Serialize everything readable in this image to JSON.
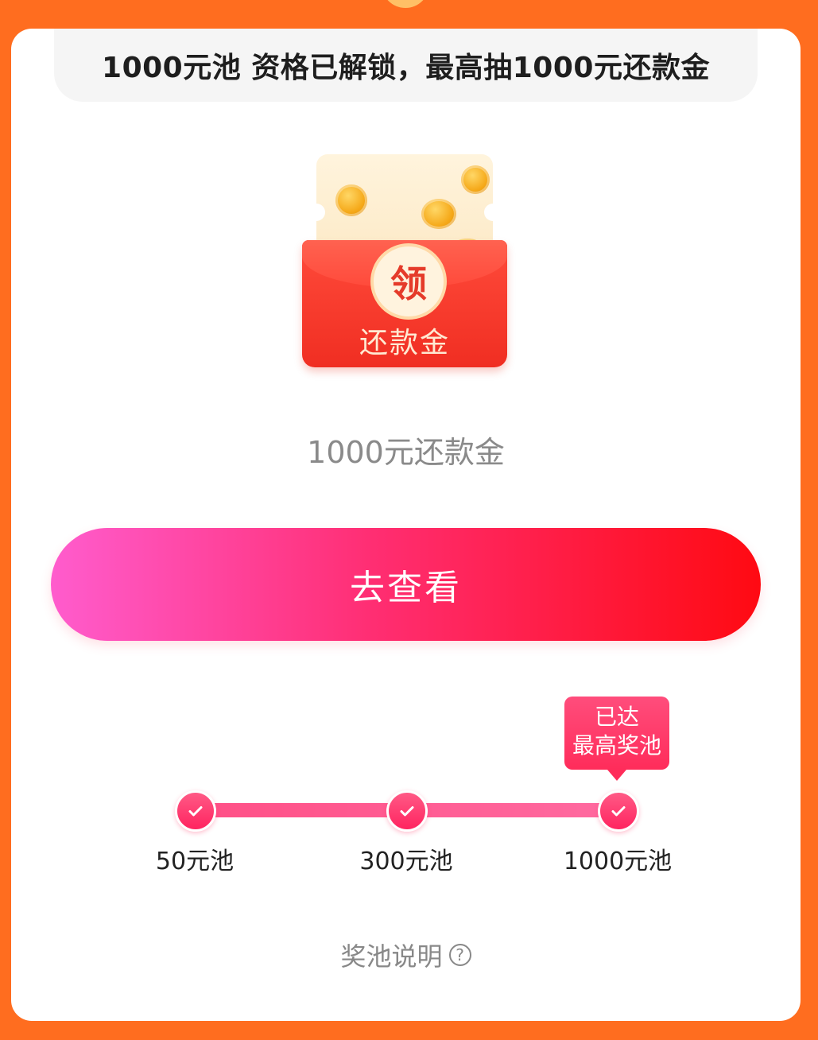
{
  "header": {
    "title": "1000元池 资格已解锁，最高抽1000元还款金"
  },
  "envelope": {
    "claim_char": "领",
    "label": "还款金",
    "icon": "red-envelope-icon"
  },
  "reward": {
    "text": "1000元还款金"
  },
  "action": {
    "view_label": "去查看"
  },
  "progress": {
    "badge_line1": "已达",
    "badge_line2": "最高奖池",
    "tiers": [
      {
        "label": "50元池",
        "reached": true
      },
      {
        "label": "300元池",
        "reached": true
      },
      {
        "label": "1000元池",
        "reached": true
      }
    ]
  },
  "footer": {
    "explain_label": "奖池说明",
    "help_icon": "question-circle-icon"
  },
  "colors": {
    "background": "#ff6d1f",
    "button_start": "#ff5ccd",
    "button_end": "#ff0a12",
    "progress": "#ff4f86"
  }
}
